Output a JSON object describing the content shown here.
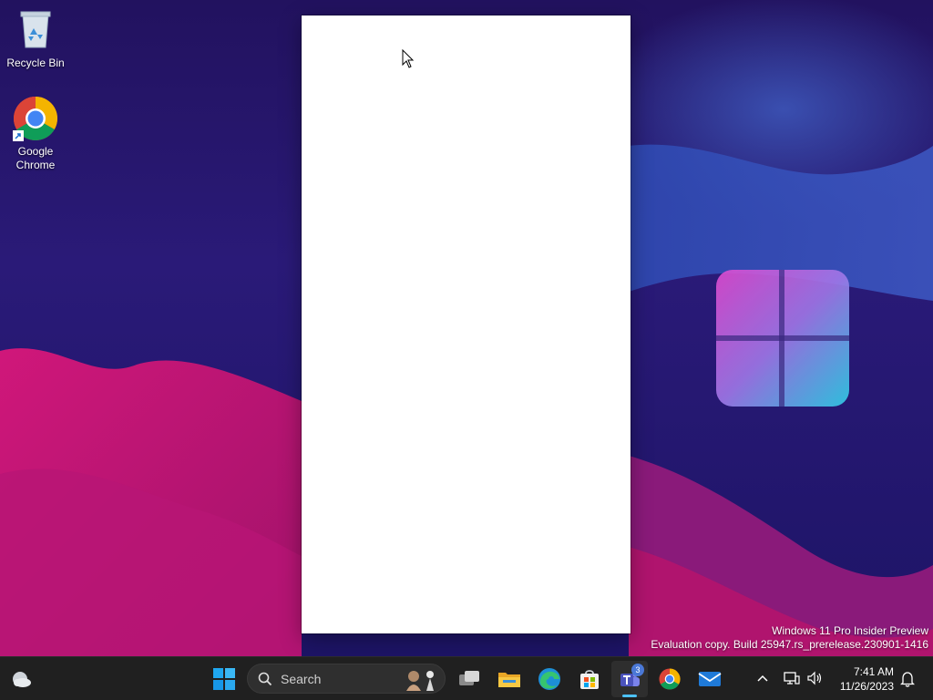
{
  "desktop": {
    "icons": [
      {
        "label": "Recycle Bin",
        "icon": "recycle-bin-icon"
      },
      {
        "label": "Google\nChrome",
        "icon": "chrome-icon"
      }
    ]
  },
  "watermark": {
    "line1": "Windows 11 Pro Insider Preview",
    "line2": "Evaluation copy. Build 25947.rs_prerelease.230901-1416"
  },
  "taskbar": {
    "search_placeholder": "Search",
    "pinned": [
      "start",
      "search",
      "task-view",
      "file-explorer",
      "edge",
      "microsoft-store",
      "teams",
      "chrome",
      "mail"
    ],
    "teams_badge": "3",
    "clock": {
      "time": "7:41 AM",
      "date": "11/26/2023"
    }
  },
  "colors": {
    "taskbar_bg": "#202020",
    "accent": "#4cc2ff",
    "window_bg": "#ffffff"
  }
}
